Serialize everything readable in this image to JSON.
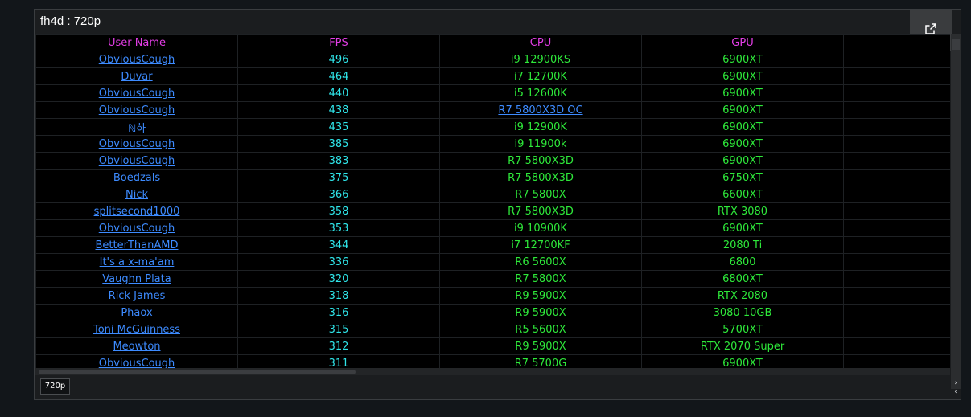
{
  "panel": {
    "title": "fh4d : 720p",
    "open_icon": "external-link-icon"
  },
  "table": {
    "columns": [
      "User Name",
      "FPS",
      "CPU",
      "GPU"
    ],
    "rows": [
      {
        "user": "ObviousCough",
        "fps": "496",
        "cpu": "i9 12900KS",
        "gpu": "6900XT"
      },
      {
        "user": "Duvar",
        "fps": "464",
        "cpu": "i7 12700K",
        "gpu": "6900XT"
      },
      {
        "user": "ObviousCough",
        "fps": "440",
        "cpu": "i5 12600K",
        "gpu": "6900XT"
      },
      {
        "user": "ObviousCough",
        "fps": "438",
        "cpu": "R7 5800X3D OC",
        "gpu": "6900XT"
      },
      {
        "user": "ℕ하",
        "fps": "435",
        "cpu": "i9 12900K",
        "gpu": "6900XT"
      },
      {
        "user": "ObviousCough",
        "fps": "385",
        "cpu": "i9 11900k",
        "gpu": "6900XT"
      },
      {
        "user": "ObviousCough",
        "fps": "383",
        "cpu": "R7 5800X3D",
        "gpu": "6900XT"
      },
      {
        "user": "Boedzals",
        "fps": "375",
        "cpu": "R7 5800X3D",
        "gpu": "6750XT"
      },
      {
        "user": "Nick",
        "fps": "366",
        "cpu": "R7 5800X",
        "gpu": "6600XT"
      },
      {
        "user": "splitsecond1000",
        "fps": "358",
        "cpu": "R7 5800X3D",
        "gpu": "RTX 3080"
      },
      {
        "user": "ObviousCough",
        "fps": "353",
        "cpu": "i9 10900K",
        "gpu": "6900XT"
      },
      {
        "user": "BetterThanAMD",
        "fps": "344",
        "cpu": "i7 12700KF",
        "gpu": "2080 Ti"
      },
      {
        "user": "It's a x-ma'am",
        "fps": "336",
        "cpu": "R6 5600X",
        "gpu": "6800"
      },
      {
        "user": "Vaughn Plata",
        "fps": "320",
        "cpu": "R7 5800X",
        "gpu": "6800XT"
      },
      {
        "user": "Rick James",
        "fps": "318",
        "cpu": "R9 5900X",
        "gpu": "RTX 2080"
      },
      {
        "user": "Phaox",
        "fps": "316",
        "cpu": "R9 5900X",
        "gpu": "3080 10GB"
      },
      {
        "user": "Toni McGuinness",
        "fps": "315",
        "cpu": "R5 5600X",
        "gpu": "5700XT"
      },
      {
        "user": "Meowton",
        "fps": "312",
        "cpu": "R9 5900X",
        "gpu": "RTX 2070 Super"
      },
      {
        "user": "ObviousCough",
        "fps": "311",
        "cpu": "R7 5700G",
        "gpu": "6900XT"
      }
    ]
  },
  "footer": {
    "tab_label": "720p",
    "scroll_arrows": [
      "›",
      "‹"
    ]
  }
}
